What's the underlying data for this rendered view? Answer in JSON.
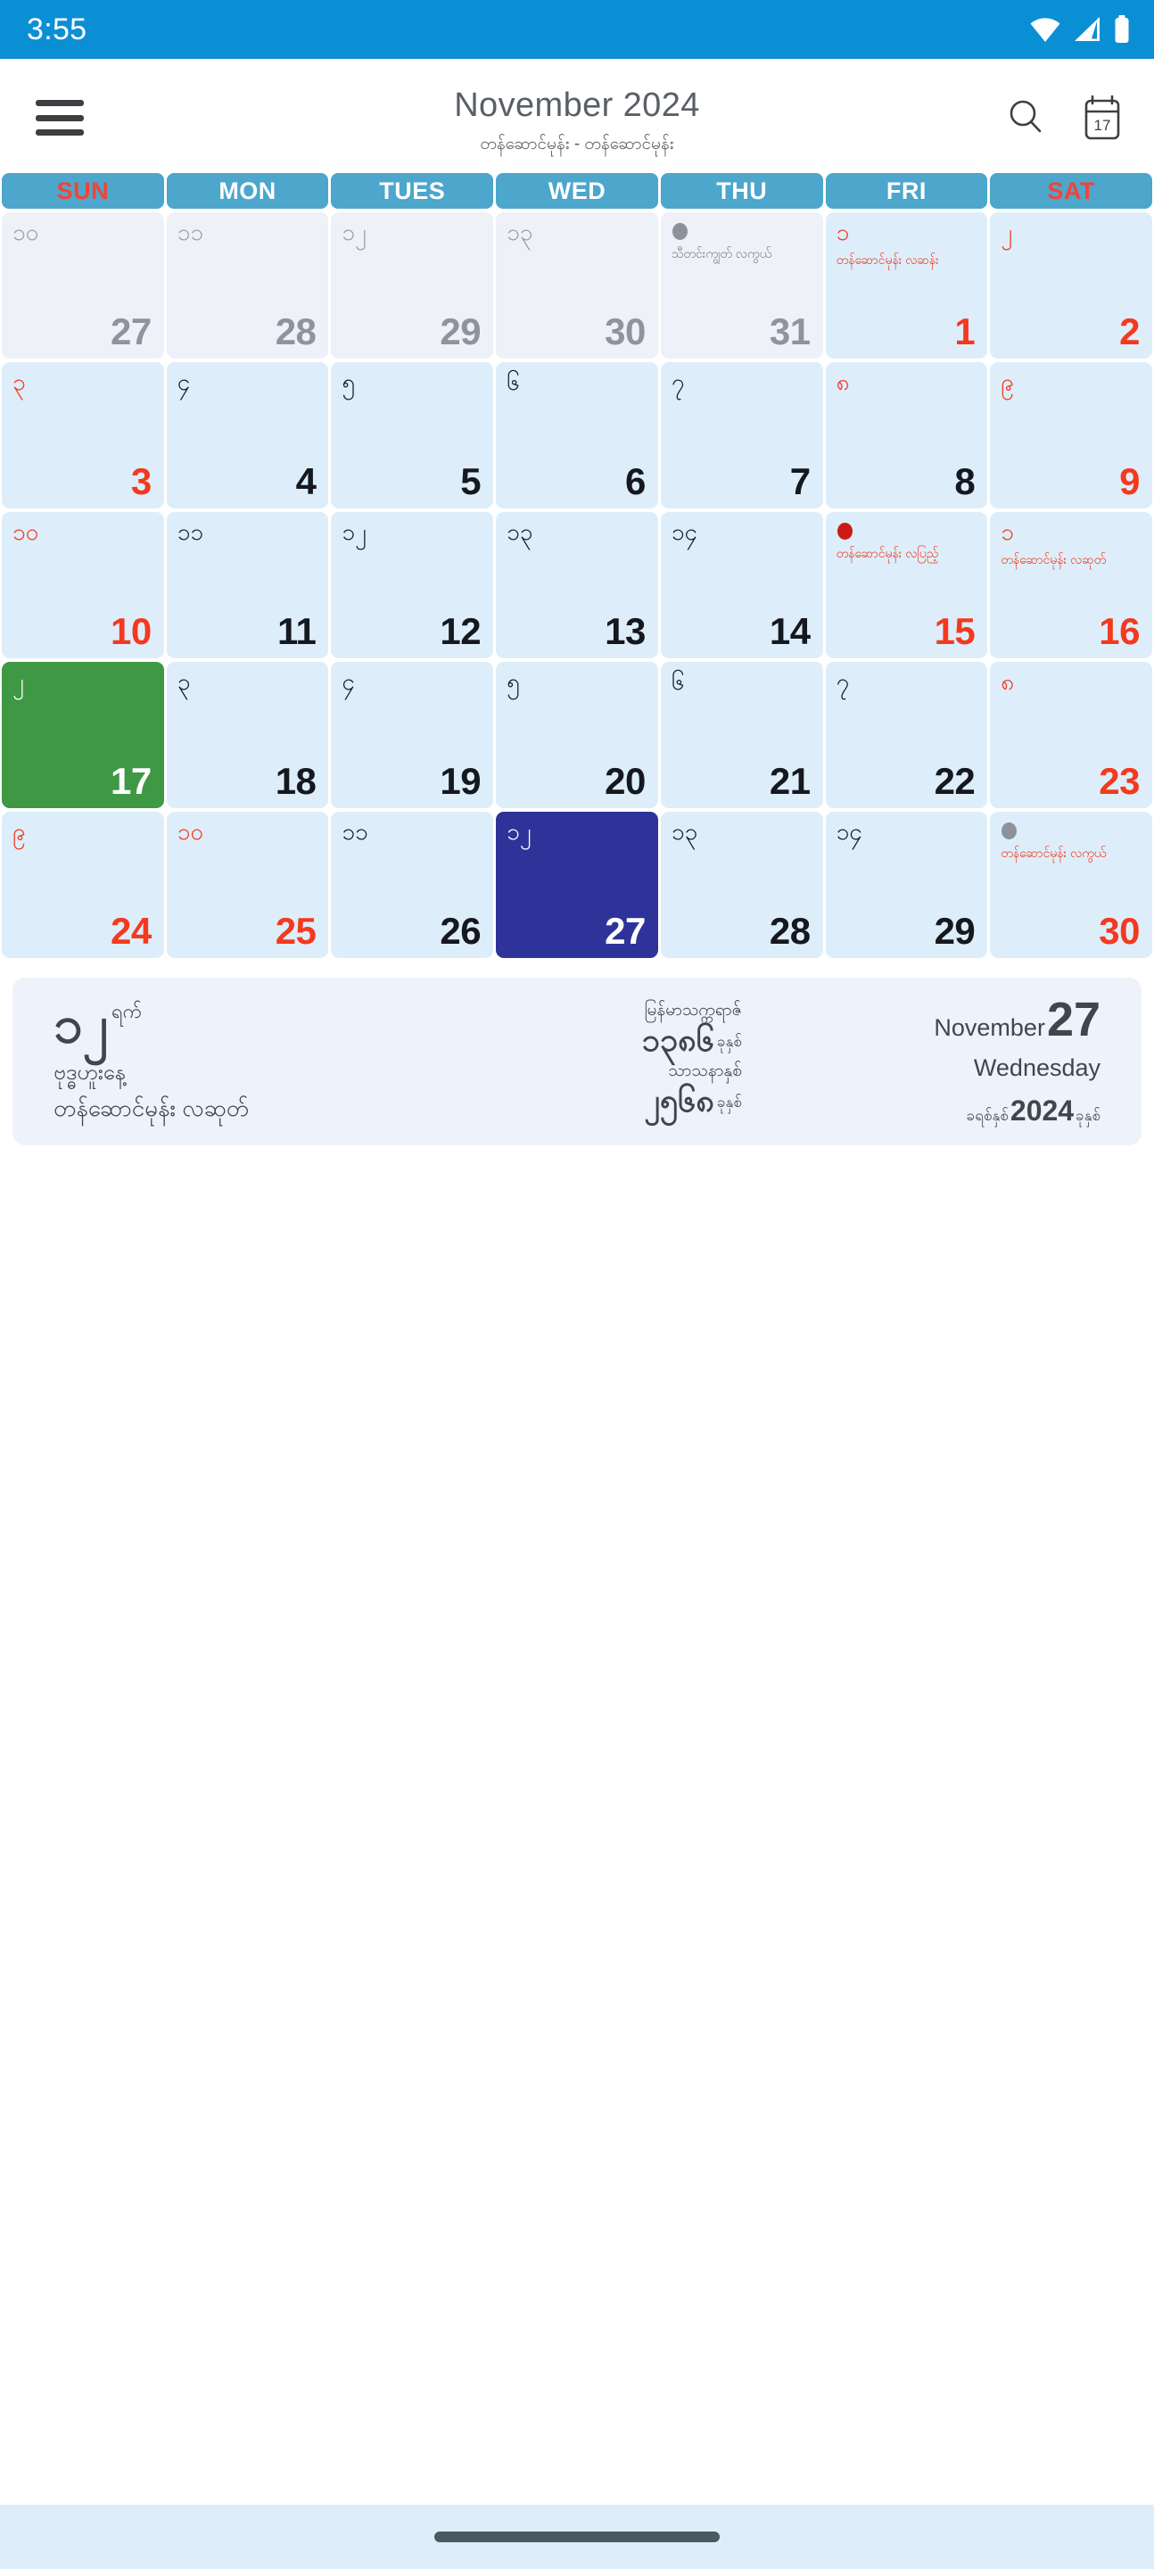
{
  "status_bar": {
    "time": "3:55",
    "icons": [
      "wifi-icon",
      "cellular-signal-icon",
      "battery-icon"
    ],
    "background": "#0b8fd4"
  },
  "header": {
    "menu_icon": "hamburger-menu-icon",
    "title": "November 2024",
    "subtitle": "တန်ဆောင်မုန်း - တန်ဆောင်မုန်း",
    "search_icon": "search-icon",
    "today_icon": "calendar-17-icon",
    "today_icon_label": "17"
  },
  "weekdays": [
    {
      "label": "SUN",
      "red": true
    },
    {
      "label": "MON",
      "red": false
    },
    {
      "label": "TUES",
      "red": false
    },
    {
      "label": "WED",
      "red": false
    },
    {
      "label": "THU",
      "red": false
    },
    {
      "label": "FRI",
      "red": false
    },
    {
      "label": "SAT",
      "red": true
    }
  ],
  "theme": {
    "status_blue": "#0b8fd4",
    "weekday_blue": "#4da6cc",
    "cell_blue": "#ddeefa",
    "cell_grey": "#eef1f7",
    "today_green": "#3f9843",
    "selected_navy": "#2e339a",
    "accent_red": "#f4391f",
    "full_moon_red": "#cc1a14",
    "new_moon_grey": "#8d9199",
    "panel_bg": "#eef2fa"
  },
  "days": [
    {
      "g": "27",
      "mm": "၁၀",
      "state": "other",
      "g_color": "muted",
      "mm_color": "muted",
      "moon": "",
      "event": "",
      "event_color": ""
    },
    {
      "g": "28",
      "mm": "၁၁",
      "state": "other",
      "g_color": "muted",
      "mm_color": "muted",
      "moon": "",
      "event": "",
      "event_color": ""
    },
    {
      "g": "29",
      "mm": "၁၂",
      "state": "other",
      "g_color": "muted",
      "mm_color": "muted",
      "moon": "",
      "event": "",
      "event_color": ""
    },
    {
      "g": "30",
      "mm": "၁၃",
      "state": "other",
      "g_color": "muted",
      "mm_color": "muted",
      "moon": "",
      "event": "",
      "event_color": ""
    },
    {
      "g": "31",
      "mm": "",
      "state": "other",
      "g_color": "muted",
      "mm_color": "muted",
      "moon": "new",
      "event": "သီတင်းကျွတ် လကွယ်",
      "event_color": "grey"
    },
    {
      "g": "1",
      "mm": "၁",
      "state": "normal",
      "g_color": "red",
      "mm_color": "red",
      "moon": "",
      "event": "တန်ဆောင်မုန်း လဆန်း",
      "event_color": "red"
    },
    {
      "g": "2",
      "mm": "၂",
      "state": "normal",
      "g_color": "red",
      "mm_color": "red",
      "moon": "",
      "event": "",
      "event_color": ""
    },
    {
      "g": "3",
      "mm": "၃",
      "state": "normal",
      "g_color": "red",
      "mm_color": "red",
      "moon": "",
      "event": "",
      "event_color": ""
    },
    {
      "g": "4",
      "mm": "၄",
      "state": "normal",
      "g_color": "normal",
      "mm_color": "normal",
      "moon": "",
      "event": "",
      "event_color": ""
    },
    {
      "g": "5",
      "mm": "၅",
      "state": "normal",
      "g_color": "normal",
      "mm_color": "normal",
      "moon": "",
      "event": "",
      "event_color": ""
    },
    {
      "g": "6",
      "mm": "၆",
      "state": "normal",
      "g_color": "normal",
      "mm_color": "normal",
      "moon": "",
      "event": "",
      "event_color": ""
    },
    {
      "g": "7",
      "mm": "၇",
      "state": "normal",
      "g_color": "normal",
      "mm_color": "normal",
      "moon": "",
      "event": "",
      "event_color": ""
    },
    {
      "g": "8",
      "mm": "၈",
      "state": "normal",
      "g_color": "normal",
      "mm_color": "red",
      "moon": "",
      "event": "",
      "event_color": ""
    },
    {
      "g": "9",
      "mm": "၉",
      "state": "normal",
      "g_color": "red",
      "mm_color": "red",
      "moon": "",
      "event": "",
      "event_color": ""
    },
    {
      "g": "10",
      "mm": "၁၀",
      "state": "normal",
      "g_color": "red",
      "mm_color": "red",
      "moon": "",
      "event": "",
      "event_color": ""
    },
    {
      "g": "11",
      "mm": "၁၁",
      "state": "normal",
      "g_color": "normal",
      "mm_color": "normal",
      "moon": "",
      "event": "",
      "event_color": ""
    },
    {
      "g": "12",
      "mm": "၁၂",
      "state": "normal",
      "g_color": "normal",
      "mm_color": "normal",
      "moon": "",
      "event": "",
      "event_color": ""
    },
    {
      "g": "13",
      "mm": "၁၃",
      "state": "normal",
      "g_color": "normal",
      "mm_color": "normal",
      "moon": "",
      "event": "",
      "event_color": ""
    },
    {
      "g": "14",
      "mm": "၁၄",
      "state": "normal",
      "g_color": "normal",
      "mm_color": "normal",
      "moon": "",
      "event": "",
      "event_color": ""
    },
    {
      "g": "15",
      "mm": "",
      "state": "normal",
      "g_color": "red",
      "mm_color": "red",
      "moon": "full",
      "event": "တန်ဆောင်မုန်း လပြည့်",
      "event_color": "red"
    },
    {
      "g": "16",
      "mm": "၁",
      "state": "normal",
      "g_color": "red",
      "mm_color": "red",
      "moon": "",
      "event": "တန်ဆောင်မုန်း လဆုတ်",
      "event_color": "red"
    },
    {
      "g": "17",
      "mm": "၂",
      "state": "today",
      "g_color": "white",
      "mm_color": "white",
      "moon": "",
      "event": "",
      "event_color": ""
    },
    {
      "g": "18",
      "mm": "၃",
      "state": "normal",
      "g_color": "normal",
      "mm_color": "normal",
      "moon": "",
      "event": "",
      "event_color": ""
    },
    {
      "g": "19",
      "mm": "၄",
      "state": "normal",
      "g_color": "normal",
      "mm_color": "normal",
      "moon": "",
      "event": "",
      "event_color": ""
    },
    {
      "g": "20",
      "mm": "၅",
      "state": "normal",
      "g_color": "normal",
      "mm_color": "normal",
      "moon": "",
      "event": "",
      "event_color": ""
    },
    {
      "g": "21",
      "mm": "၆",
      "state": "normal",
      "g_color": "normal",
      "mm_color": "normal",
      "moon": "",
      "event": "",
      "event_color": ""
    },
    {
      "g": "22",
      "mm": "၇",
      "state": "normal",
      "g_color": "normal",
      "mm_color": "normal",
      "moon": "",
      "event": "",
      "event_color": ""
    },
    {
      "g": "23",
      "mm": "၈",
      "state": "normal",
      "g_color": "red",
      "mm_color": "red",
      "moon": "",
      "event": "",
      "event_color": ""
    },
    {
      "g": "24",
      "mm": "၉",
      "state": "normal",
      "g_color": "red",
      "mm_color": "red",
      "moon": "",
      "event": "",
      "event_color": ""
    },
    {
      "g": "25",
      "mm": "၁၀",
      "state": "normal",
      "g_color": "red",
      "mm_color": "red",
      "moon": "",
      "event": "",
      "event_color": ""
    },
    {
      "g": "26",
      "mm": "၁၁",
      "state": "normal",
      "g_color": "normal",
      "mm_color": "normal",
      "moon": "",
      "event": "",
      "event_color": ""
    },
    {
      "g": "27",
      "mm": "၁၂",
      "state": "selected",
      "g_color": "white",
      "mm_color": "white",
      "moon": "",
      "event": "",
      "event_color": ""
    },
    {
      "g": "28",
      "mm": "၁၃",
      "state": "normal",
      "g_color": "normal",
      "mm_color": "normal",
      "moon": "",
      "event": "",
      "event_color": ""
    },
    {
      "g": "29",
      "mm": "၁၄",
      "state": "normal",
      "g_color": "normal",
      "mm_color": "normal",
      "moon": "",
      "event": "",
      "event_color": ""
    },
    {
      "g": "30",
      "mm": "",
      "state": "normal",
      "g_color": "red",
      "mm_color": "red",
      "moon": "new",
      "event": "တန်ဆောင်မုန်း လကွယ်",
      "event_color": "red"
    }
  ],
  "info_panel": {
    "left": {
      "day_number": "၁၂",
      "day_suffix": "ရက်",
      "weekday": "ဗုဒ္ဓဟူးနေ့",
      "moon_phase": "တန်ဆောင်မုန်း လဆုတ်"
    },
    "center": {
      "era_label": "မြန်မာသက္ကရာဇ်",
      "era_year": "၁၃၈၆",
      "era_year_suffix": "ခုနှစ်",
      "sasana_label": "သာသနာနှစ်",
      "sasana_year": "၂၅၆၈",
      "sasana_year_suffix": "ခုနှစ်"
    },
    "right": {
      "month": "November",
      "day": "27",
      "weekday": "Wednesday",
      "year_prefix": "ခရစ်နှစ်",
      "year": "2024",
      "year_suffix": "ခုနှစ်"
    }
  },
  "nav_bar": {
    "gesture_pill": "home-gesture-pill"
  }
}
